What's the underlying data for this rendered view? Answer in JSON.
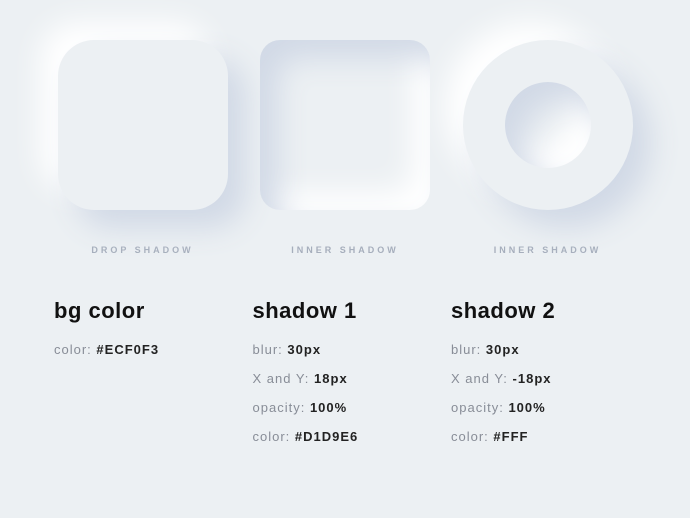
{
  "shapes": {
    "drop": {
      "caption": "DROP SHADOW"
    },
    "innerSquare": {
      "caption": "INNER SHADOW"
    },
    "innerRing": {
      "caption": "INNER SHADOW"
    }
  },
  "bg": {
    "title": "bg color",
    "color_label": "color:",
    "color_value": "#ECF0F3"
  },
  "shadow1": {
    "title": "shadow 1",
    "blur_label": "blur:",
    "blur_value": "30px",
    "xy_label": "X and Y:",
    "xy_value": "18px",
    "opacity_label": "opacity:",
    "opacity_value": "100%",
    "color_label": "color:",
    "color_value": "#D1D9E6"
  },
  "shadow2": {
    "title": "shadow 2",
    "blur_label": "blur:",
    "blur_value": "30px",
    "xy_label": "X and Y:",
    "xy_value": "-18px",
    "opacity_label": "opacity:",
    "opacity_value": "100%",
    "color_label": "color:",
    "color_value": "#FFF"
  }
}
